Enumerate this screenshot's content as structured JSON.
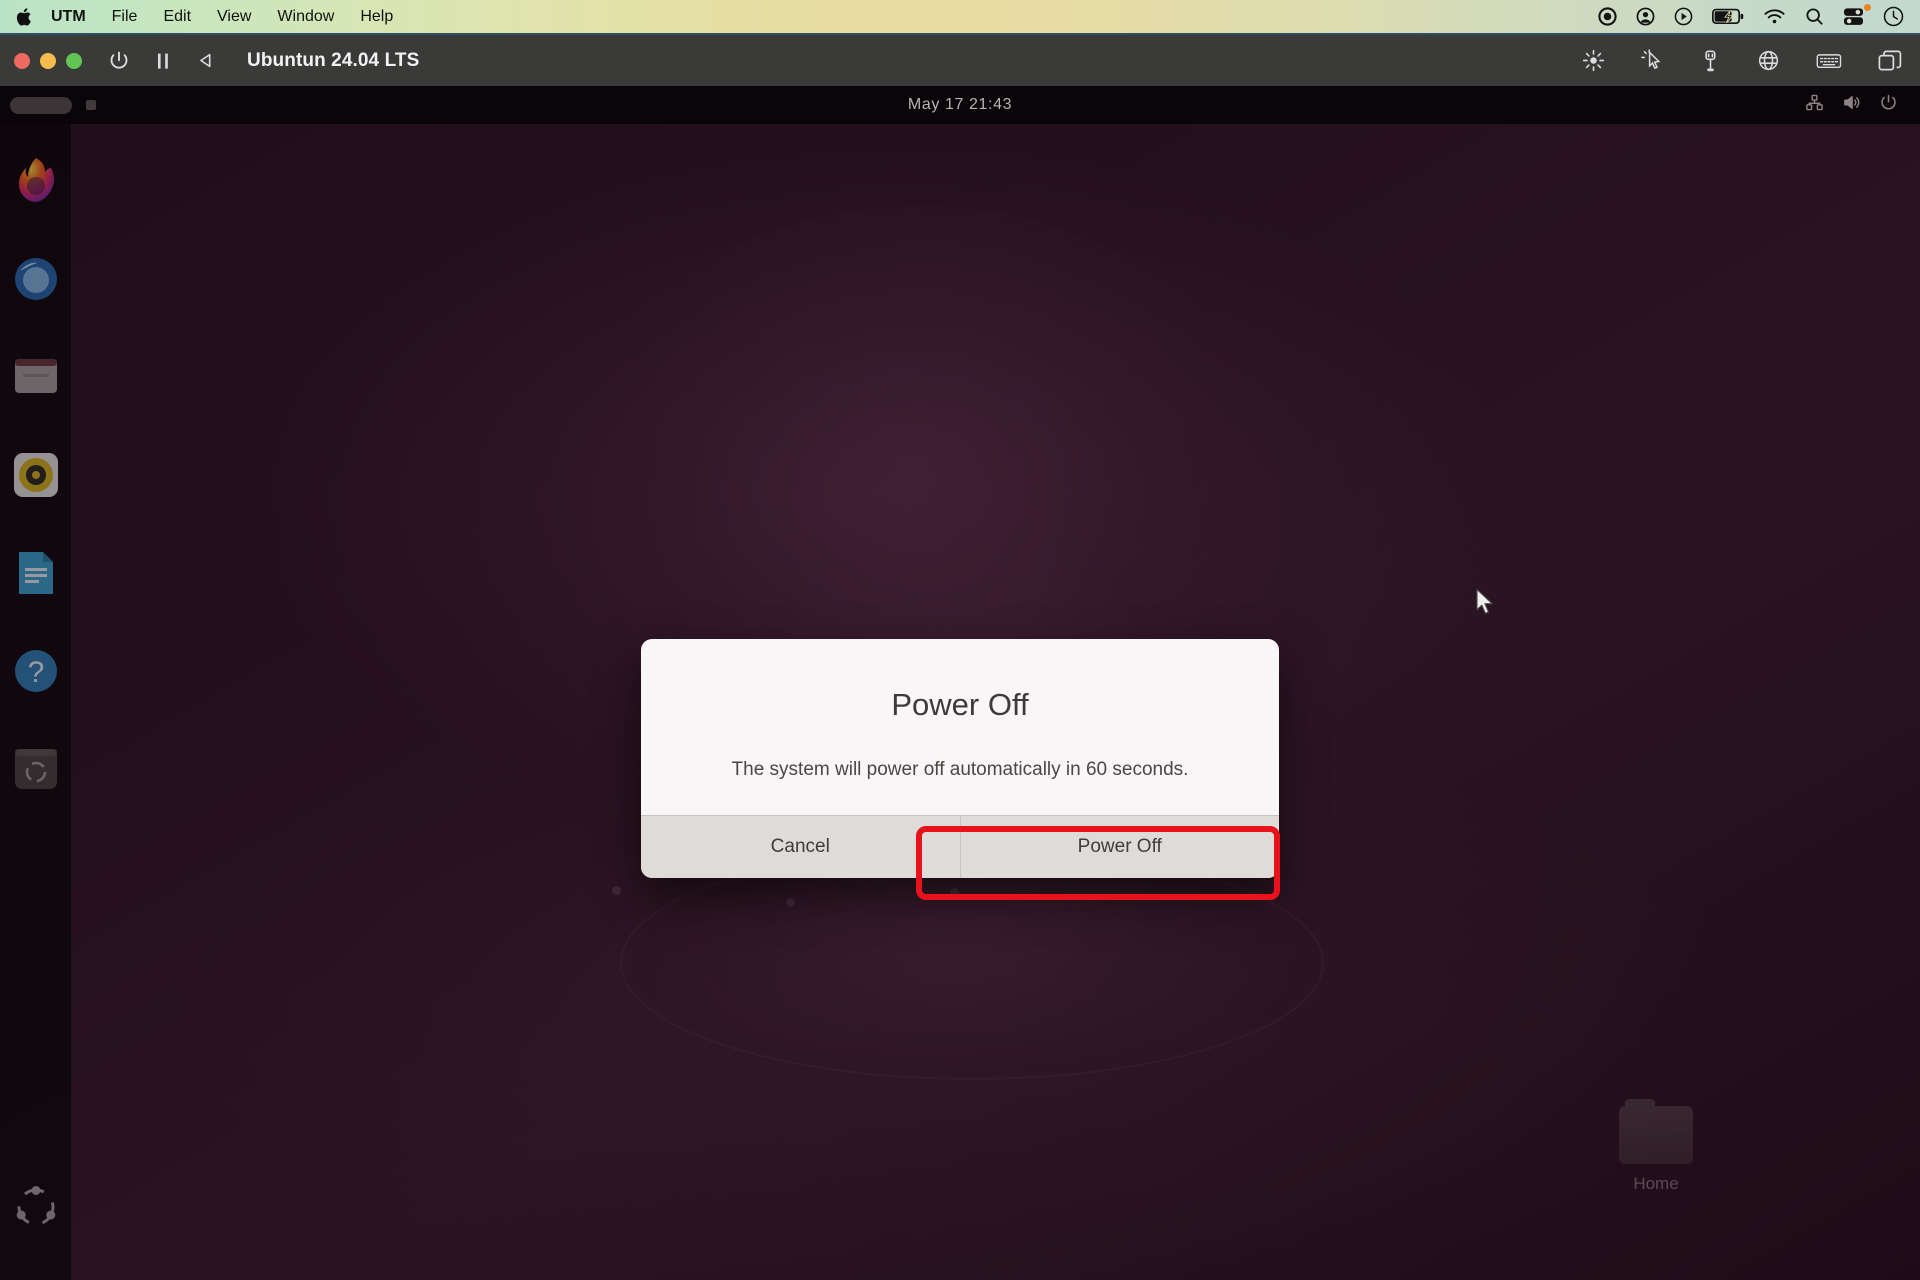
{
  "mac_menubar": {
    "apple_icon": "apple-logo-icon",
    "items": [
      {
        "label": "UTM",
        "bold": true
      },
      {
        "label": "File",
        "bold": false
      },
      {
        "label": "Edit",
        "bold": false
      },
      {
        "label": "View",
        "bold": false
      },
      {
        "label": "Window",
        "bold": false
      },
      {
        "label": "Help",
        "bold": false
      }
    ],
    "status_icons": [
      "record-icon",
      "account-icon",
      "play-circle-icon",
      "battery-charging-icon",
      "wifi-icon",
      "search-icon",
      "control-center-icon",
      "siri-icon"
    ],
    "gradient_start": "#b9e3c6",
    "gradient_mid": "#e9dca0",
    "gradient_end": "#c2d9cf"
  },
  "utm_window": {
    "title": "Ubuntun 24.04 LTS",
    "traffic_lights": [
      "close-button",
      "minimize-button",
      "zoom-button"
    ],
    "left_tools": [
      "power-icon",
      "pause-icon",
      "back-triangle-icon"
    ],
    "right_tools": [
      "brightness-icon",
      "pointer-capture-icon",
      "usb-icon",
      "network-icon",
      "keyboard-icon",
      "windows-icon"
    ],
    "titlebar_color": "#3a3a38"
  },
  "gnome": {
    "activities_label": "",
    "clock": "May 17  21:43",
    "status_icons": [
      "network-icon",
      "volume-icon",
      "power-menu-icon"
    ],
    "dock_items": [
      {
        "name": "firefox",
        "label": "Firefox"
      },
      {
        "name": "thunderbird",
        "label": "Thunderbird"
      },
      {
        "name": "files",
        "label": "Files"
      },
      {
        "name": "rhythmbox",
        "label": "Rhythmbox"
      },
      {
        "name": "libreoffice-writer",
        "label": "LibreOffice Writer"
      },
      {
        "name": "help",
        "label": "Help"
      },
      {
        "name": "ubuntu-software",
        "label": "Ubuntu Software"
      }
    ],
    "show_applications": "show-applications-grid",
    "desktop_icons": [
      {
        "name": "home-folder",
        "label": "Home"
      }
    ]
  },
  "dialog": {
    "title": "Power Off",
    "message": "The system will power off automatically in 60 seconds.",
    "buttons": [
      {
        "name": "cancel-button",
        "label": "Cancel",
        "highlighted": false
      },
      {
        "name": "power-off-button",
        "label": "Power Off",
        "highlighted": true
      }
    ],
    "background": "#f8f6f6",
    "button_bar_color": "#dedbd9"
  },
  "annotation": {
    "highlight_color": "#e8121a",
    "target": "power-off-button"
  }
}
